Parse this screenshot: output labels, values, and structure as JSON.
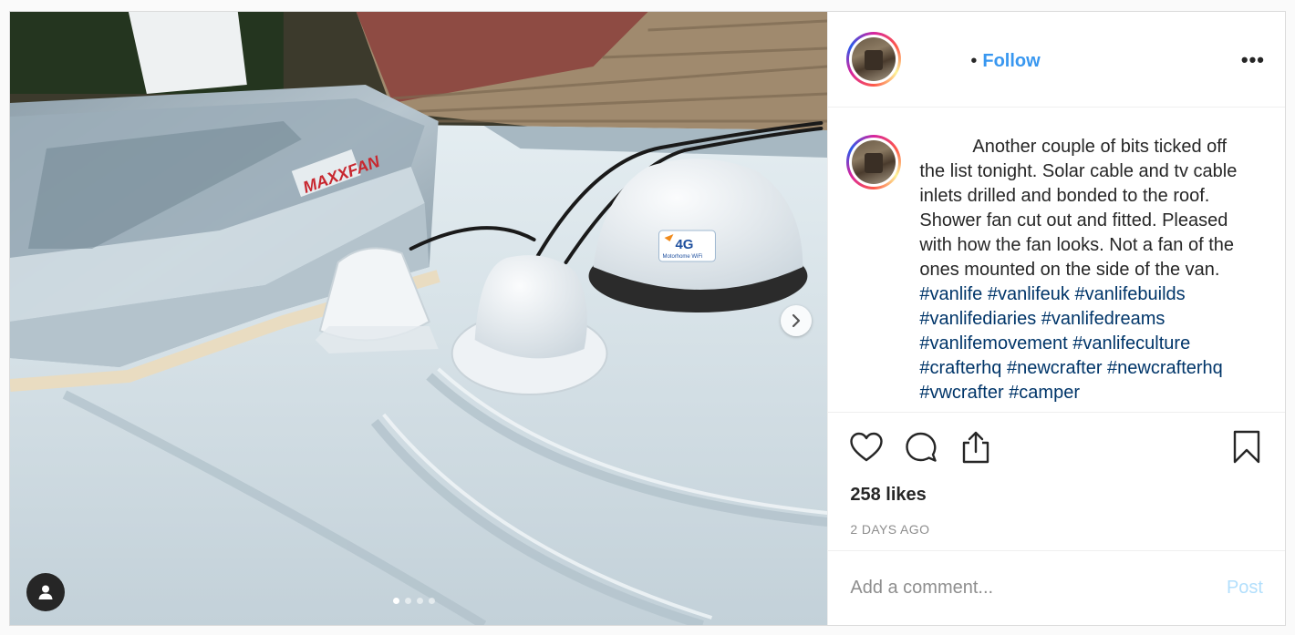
{
  "header": {
    "separator": "•",
    "follow_label": "Follow",
    "more_label": "•••"
  },
  "caption": {
    "text": "Another couple of bits ticked off the list tonight. Solar cable and tv cable inlets drilled and bonded to the roof. Shower fan cut out and fitted. Pleased with how the fan looks. Not a fan of the ones mounted on the side of the van. ",
    "hashtags": [
      "#vanlife",
      "#vanlifeuk",
      "#vanlifebuilds",
      "#vanlifediaries",
      "#vanlifedreams",
      "#vanlifemovement",
      "#vanlifeculture",
      "#crafterhq",
      "#newcrafter",
      "#newcrafterhq",
      "#vwcrafter",
      "#camper"
    ]
  },
  "media": {
    "fan_brand": "MAXXFAN",
    "antenna_label": "4G",
    "antenna_sublabel": "Motorhome WiFi",
    "carousel_count": 4,
    "carousel_active": 0
  },
  "stats": {
    "likes": "258 likes",
    "date": "2 DAYS AGO"
  },
  "comment": {
    "placeholder": "Add a comment...",
    "post_label": "Post"
  },
  "icons": {
    "like": "heart-icon",
    "comment": "comment-bubble-icon",
    "share": "share-icon",
    "save": "bookmark-icon",
    "next": "chevron-right-icon",
    "tags": "user-icon"
  },
  "colors": {
    "link": "#3897f0",
    "hashtag": "#003569",
    "post_disabled": "#b2dffc",
    "muted": "#8e8e8e"
  }
}
